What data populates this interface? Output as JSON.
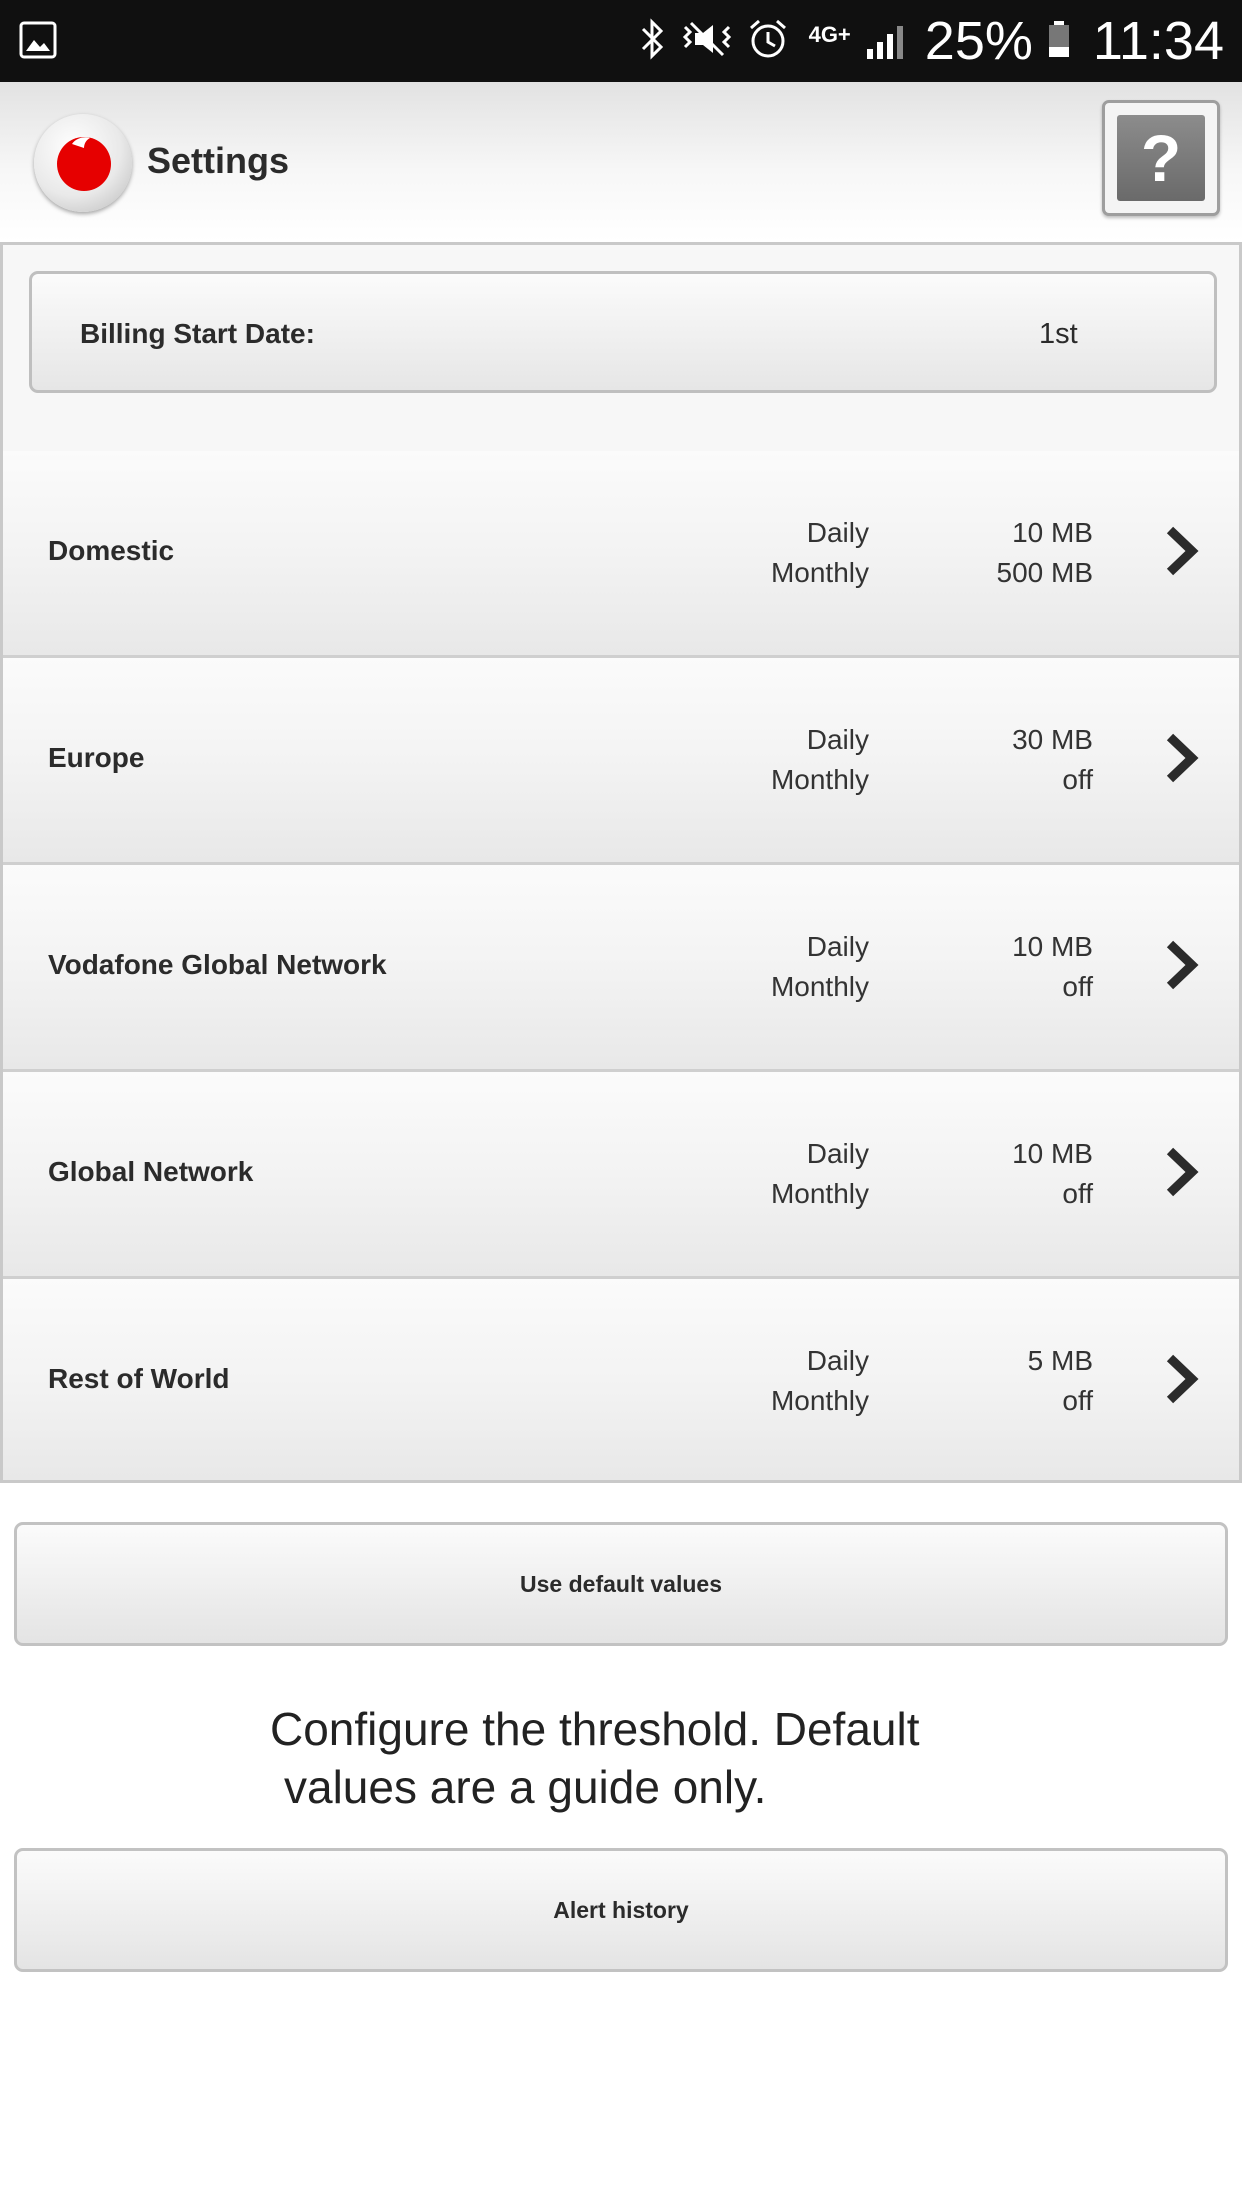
{
  "status_bar": {
    "network": "4G+",
    "battery": "25%",
    "time": "11:34"
  },
  "header": {
    "title": "Settings",
    "help_label": "?"
  },
  "billing": {
    "label": "Billing Start Date:",
    "value": "1st"
  },
  "rows": [
    {
      "name": "Domestic",
      "label_daily": "Daily",
      "label_monthly": "Monthly",
      "daily": "10 MB",
      "monthly": "500 MB"
    },
    {
      "name": "Europe",
      "label_daily": "Daily",
      "label_monthly": "Monthly",
      "daily": "30 MB",
      "monthly": "off"
    },
    {
      "name": "Vodafone Global Network",
      "label_daily": "Daily",
      "label_monthly": "Monthly",
      "daily": "10 MB",
      "monthly": "off"
    },
    {
      "name": "Global Network",
      "label_daily": "Daily",
      "label_monthly": "Monthly",
      "daily": "10 MB",
      "monthly": "off"
    },
    {
      "name": "Rest of World",
      "label_daily": "Daily",
      "label_monthly": "Monthly",
      "daily": "5 MB",
      "monthly": "off"
    }
  ],
  "buttons": {
    "defaults": "Use default values",
    "history": "Alert history"
  },
  "info": {
    "line1": "Configure the threshold. Default",
    "line2": "values are a guide only."
  },
  "icons": {
    "gallery": "gallery-icon",
    "bluetooth": "bluetooth-icon",
    "mute": "vibrate-mute-icon",
    "alarm": "alarm-icon",
    "signal": "signal-icon",
    "battery": "battery-icon",
    "chevron": "chevron-right-icon"
  },
  "colors": {
    "brand": "#e60000",
    "status_bar": "#101010"
  }
}
